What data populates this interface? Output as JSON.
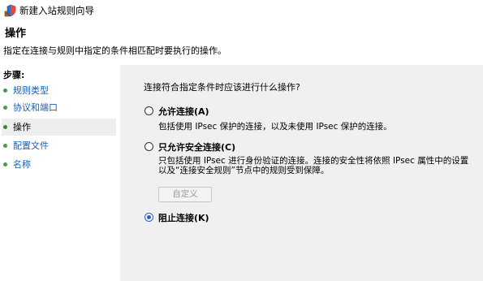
{
  "window": {
    "title": "新建入站规则向导",
    "icon": "firewall-shield-icon"
  },
  "page": {
    "title": "操作",
    "description": "指定在连接与规则中指定的条件相匹配时要执行的操作。"
  },
  "steps": {
    "header": "步骤:",
    "items": [
      {
        "label": "规则类型",
        "active": false
      },
      {
        "label": "协议和端口",
        "active": false
      },
      {
        "label": "操作",
        "active": true
      },
      {
        "label": "配置文件",
        "active": false
      },
      {
        "label": "名称",
        "active": false
      }
    ]
  },
  "content": {
    "question": "连接符合指定条件时应该进行什么操作?",
    "options": [
      {
        "label": "允许连接(A)",
        "description": "包括使用 IPsec 保护的连接，以及未使用 IPsec 保护的连接。",
        "selected": false
      },
      {
        "label": "只允许安全连接(C)",
        "description": "只包括使用 IPsec 进行身份验证的连接。连接的安全性将依照 IPsec 属性中的设置以及“连接安全规则”节点中的规则受到保障。",
        "selected": false
      },
      {
        "label": "阻止连接(K)",
        "selected": true
      }
    ],
    "customize_button": "自定义"
  }
}
